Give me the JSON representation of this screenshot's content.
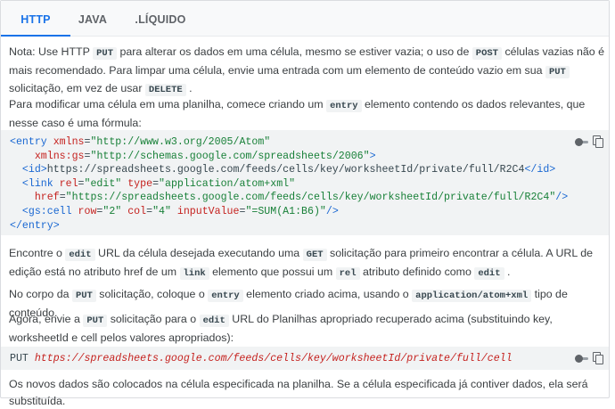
{
  "tabs": [
    {
      "label": "HTTP",
      "active": true
    },
    {
      "label": "JAVA",
      "active": false
    },
    {
      "label": ".LÍQUIDO",
      "active": false
    }
  ],
  "p1": {
    "s1": "Nota: Use HTTP ",
    "c1": "PUT",
    "s2": " para alterar os dados em uma célula, mesmo se estiver vazia; o uso de ",
    "c2": "POST",
    "s3": " células vazias não é mais recomendado. Para limpar uma célula, envie uma entrada com um elemento de conteúdo vazio em sua ",
    "c3": "PUT",
    "s4": " solicitação, em vez de usar ",
    "c4": "DELETE",
    "s5": " ."
  },
  "p2": {
    "s1": "Para modificar uma célula em uma planilha, comece criando um ",
    "c1": "entry",
    "s2": " elemento contendo os dados relevantes, que nesse caso é uma fórmula:"
  },
  "code1": {
    "l1": {
      "a": "<entry ",
      "b": "xmlns",
      "c": "=",
      "d": "\"http://www.w3.org/2005/Atom\""
    },
    "l2": {
      "a": "    ",
      "b": "xmlns:gs",
      "c": "=",
      "d": "\"http://schemas.google.com/spreadsheets/2006\"",
      "e": ">"
    },
    "l3": {
      "a": "  <id>",
      "b": "https://spreadsheets.google.com/feeds/cells/key/worksheetId/private/full/R2C4",
      "c": "</id>"
    },
    "l4": {
      "a": "  <link ",
      "b": "rel",
      "c": "=",
      "d": "\"edit\"",
      "e": " type",
      "f": "=",
      "g": "\"application/atom+xml\""
    },
    "l5": {
      "a": "    ",
      "b": "href",
      "c": "=",
      "d": "\"https://spreadsheets.google.com/feeds/cells/key/worksheetId/private/full/R2C4\"",
      "e": "/>"
    },
    "l6": {
      "a": "  <gs:cell ",
      "b": "row",
      "c": "=",
      "d": "\"2\"",
      "e": " col",
      "f": "=",
      "g": "\"4\"",
      "h": " inputValue",
      "i": "=",
      "j": "\"=SUM(A1:B6)\"",
      "k": "/>"
    },
    "l7": {
      "a": "</entry>"
    }
  },
  "p3": {
    "s1": "Encontre o ",
    "c1": "edit",
    "s2": " URL da célula desejada executando uma ",
    "c2": "GET",
    "s3": " solicitação para primeiro encontrar a célula. A URL de edição está no atributo href de um ",
    "c3": "link",
    "s4": " elemento que possui um ",
    "c4": "rel",
    "s5": " atributo definido como ",
    "c5": "edit",
    "s6": " ."
  },
  "p4": {
    "s1": "No corpo da ",
    "c1": "PUT",
    "s2": " solicitação, coloque o ",
    "c2": "entry",
    "s3": " elemento criado acima, usando o ",
    "c3": "application/atom+xml",
    "s4": " tipo de conteúdo."
  },
  "p5": {
    "s1": "Agora, envie a ",
    "c1": "PUT",
    "s2": " solicitação para o ",
    "c2": "edit",
    "s3": " URL do Planilhas apropriado recuperado acima (substituindo key, worksheetId e cell pelos valores apropriados):"
  },
  "code2": {
    "method": "PUT ",
    "url": "https://spreadsheets.google.com/feeds/cells/key/worksheetId/private/full/cell"
  },
  "p6": "Os novos dados são colocados na célula especificada na planilha. Se a célula especificada já contiver dados, ela será substituída.",
  "icons": {
    "toggle": "dark-mode-toggle-icon",
    "copy": "copy-icon"
  }
}
